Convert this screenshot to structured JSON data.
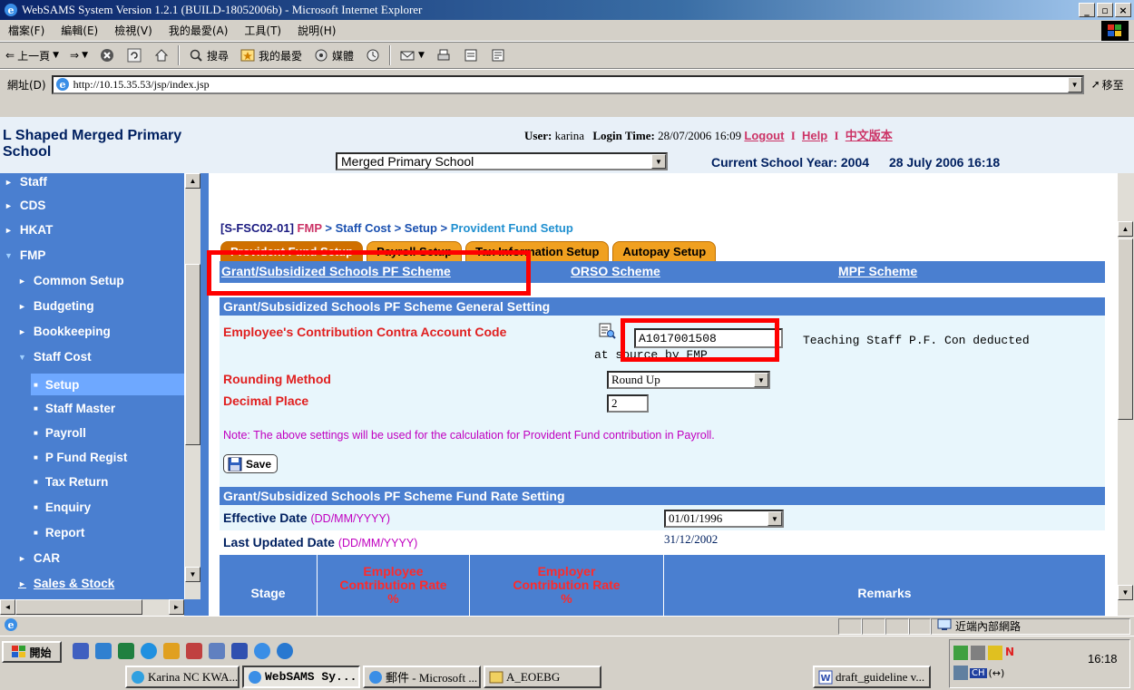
{
  "window": {
    "title": "WebSAMS System Version 1.2.1 (BUILD-18052006b) - Microsoft Internet Explorer",
    "min": "_",
    "max": "ё",
    "close": "×"
  },
  "menu": [
    "檔案(F)",
    "編輯(E)",
    "檢視(V)",
    "我的最愛(A)",
    "工具(T)",
    "說明(H)"
  ],
  "toolbar": {
    "back": "上一頁",
    "search": "搜尋",
    "favorites": "我的最愛",
    "media": "媒體"
  },
  "address": {
    "label": "網址(D)",
    "url": "http://10.15.35.53/jsp/index.jsp",
    "go": "移至"
  },
  "header": {
    "school_line1": "L Shaped Merged Primary",
    "school_line2": "School",
    "user_label": "User:",
    "user": "karina",
    "login_label": "Login Time:",
    "login_time": "28/07/2006 16:09",
    "logout": "Logout",
    "help": "Help",
    "chinese": "中文版本",
    "school_select": "Merged Primary School",
    "year_label": "Current School Year: 2004",
    "date": "28 July 2006 16:18"
  },
  "nav": {
    "staff": "Staff",
    "cds": "CDS",
    "hkat": "HKAT",
    "fmp": "FMP",
    "common_setup": "Common Setup",
    "budgeting": "Budgeting",
    "bookkeeping": "Bookkeeping",
    "staff_cost": "Staff Cost",
    "setup": "Setup",
    "staff_master": "Staff Master",
    "payroll": "Payroll",
    "p_fund": "P Fund Regist",
    "tax_return": "Tax Return",
    "enquiry": "Enquiry",
    "report": "Report",
    "car": "CAR",
    "sales": "Sales & Stock"
  },
  "breadcrumb": {
    "code": "[S-FSC02-01]",
    "fmp": "FMP",
    "mid": "> Staff Cost > Setup >",
    "last": "Provident Fund Setup"
  },
  "tabs": [
    "Provident Fund Setup",
    "Payroll Setup",
    "Tax Information Setup",
    "Autopay Setup"
  ],
  "subtabs": [
    "Grant/Subsidized Schools PF Scheme",
    "ORSO Scheme",
    "MPF Scheme"
  ],
  "general": {
    "heading": "Grant/Subsidized Schools PF Scheme General Setting",
    "contra_label": "Employee's Contribution Contra Account Code",
    "contra_value": "A1017001508",
    "contra_desc": "Teaching Staff P.F. Con deducted",
    "contra_desc2": "at source by FMP",
    "rounding_label": "Rounding Method",
    "rounding_value": "Round Up",
    "decimal_label": "Decimal Place",
    "decimal_value": "2",
    "note": "Note: The above settings will be used for the calculation for Provident Fund contribution in Payroll.",
    "save": "Save"
  },
  "rate": {
    "heading": "Grant/Subsidized Schools PF Scheme Fund Rate Setting",
    "effective_label": "Effective Date",
    "effective_fmt": "(DD/MM/YYYY)",
    "effective_value": "01/01/1996",
    "updated_label": "Last Updated Date",
    "updated_fmt": "(DD/MM/YYYY)",
    "updated_value": "31/12/2002",
    "col_stage": "Stage",
    "col_employee1": "Employee",
    "col_employee2": "Contribution Rate",
    "col_employee3": "%",
    "col_employer1": "Employer",
    "col_employer2": "Contribution Rate",
    "col_employer3": "%",
    "col_remarks": "Remarks"
  },
  "status": {
    "zone": "近端內部網路"
  },
  "taskbar": {
    "start": "開始",
    "buttons": [
      "Karina NC KWA...",
      "WebSAMS Sy...",
      "郵件 - Microsoft ...",
      "A_EOEBG",
      "draft_guideline v..."
    ],
    "clock": "16:18",
    "ime": "CH"
  },
  "colors": {
    "nav_blue": "#4a7fd0",
    "tab_orange": "#f0a020",
    "highlight_red": "#ff0000"
  }
}
